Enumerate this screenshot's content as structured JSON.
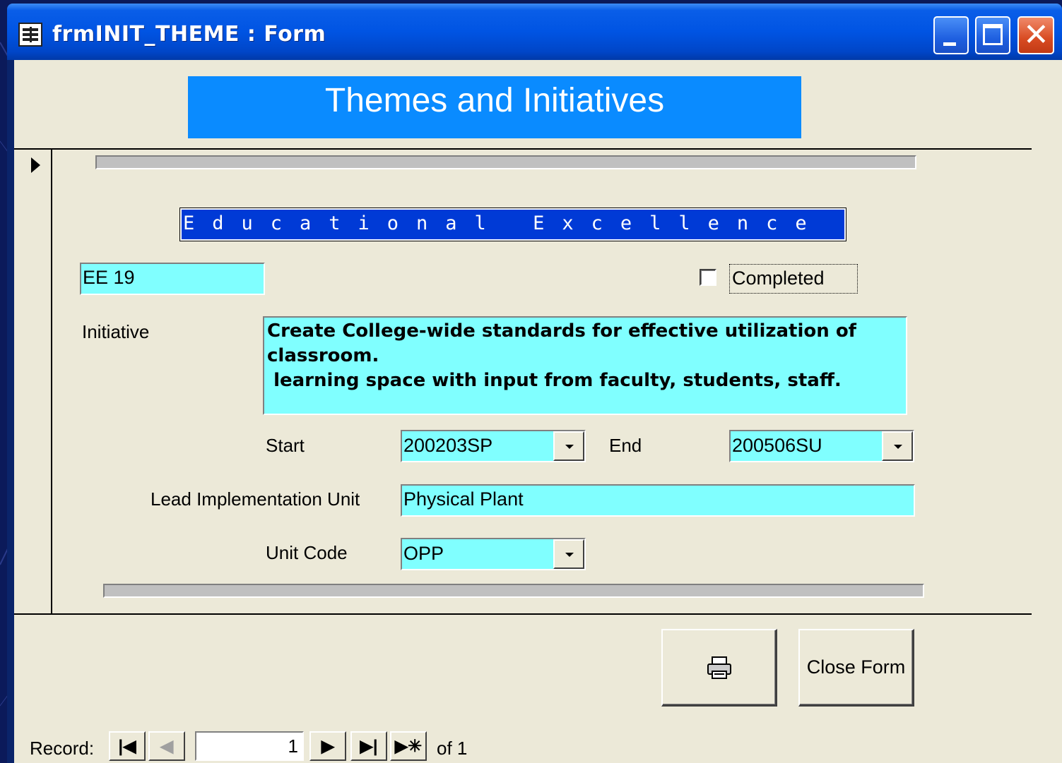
{
  "window": {
    "title": "frmINIT_THEME : Form"
  },
  "form": {
    "header": "Themes and Initiatives",
    "theme": "Educational Excellence",
    "code": "EE 19",
    "completed_label": "Completed",
    "completed": false,
    "initiative_label": "Initiative",
    "initiative_text": "Create College-wide standards for effective utilization of classroom.\n learning space with input from faculty, students, staff.",
    "start_label": "Start",
    "start_value": "200203SP",
    "end_label": "End",
    "end_value": "200506SU",
    "lead_label": "Lead Implementation Unit",
    "lead_value": "Physical Plant",
    "unit_code_label": "Unit Code",
    "unit_code_value": "OPP",
    "close_button": "Close Form",
    "print_icon": "printer-icon"
  },
  "navigation": {
    "record_label": "Record:",
    "current": "1",
    "total_text": "of 1",
    "first": "first-record-icon",
    "prev": "previous-record-icon",
    "next": "next-record-icon",
    "last": "last-record-icon",
    "new": "new-record-icon"
  }
}
